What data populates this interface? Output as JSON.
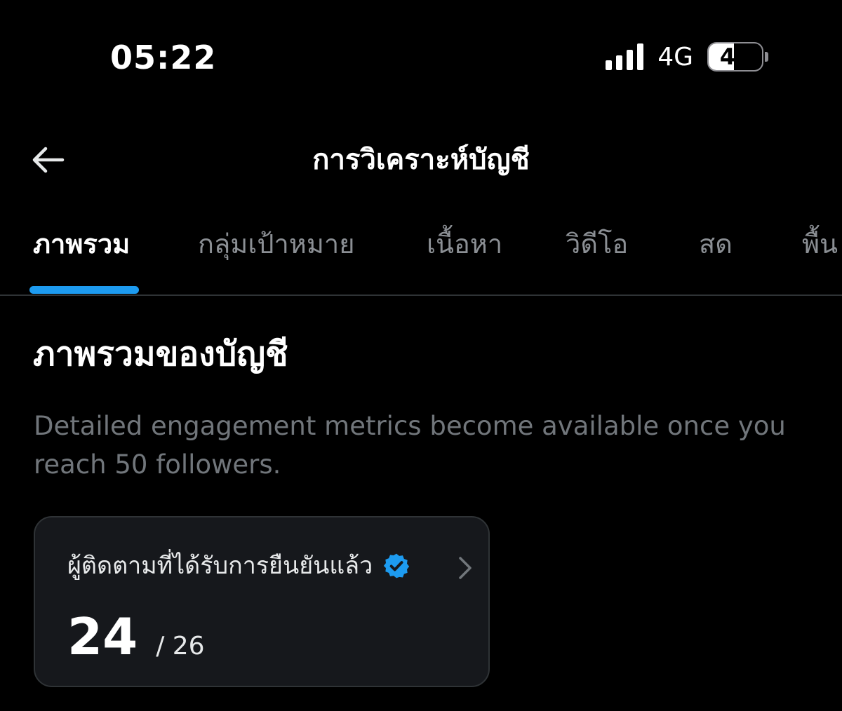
{
  "status_bar": {
    "time": "05:22",
    "network": "4G",
    "battery_level": "48",
    "battery_fraction": 0.48,
    "signal_icon": "signal-bars-icon"
  },
  "header": {
    "back_icon": "arrow-left-icon",
    "title": "การวิเคราะห์บัญชี"
  },
  "tabs": [
    {
      "label": "ภาพรวม",
      "active": true
    },
    {
      "label": "กลุ่มเป้าหมาย",
      "active": false
    },
    {
      "label": "เนื้อหา",
      "active": false
    },
    {
      "label": "วิดีโอ",
      "active": false
    },
    {
      "label": "สด",
      "active": false
    },
    {
      "label": "พื้น",
      "active": false
    }
  ],
  "overview": {
    "title": "ภาพรวมของบัญชี",
    "description": "Detailed engagement metrics become available once you reach 50 followers."
  },
  "metric_card": {
    "label": "ผู้ติดตามที่ได้รับการยืนยันแล้ว",
    "value": "24",
    "total": "/ 26",
    "badge_icon": "verified-badge-icon",
    "arrow_icon": "chevron-right-icon"
  },
  "colors": {
    "background": "#000000",
    "accent": "#1d9bf0",
    "muted_text": "#71767b",
    "card_background": "#16181c",
    "divider": "#2f3336"
  }
}
